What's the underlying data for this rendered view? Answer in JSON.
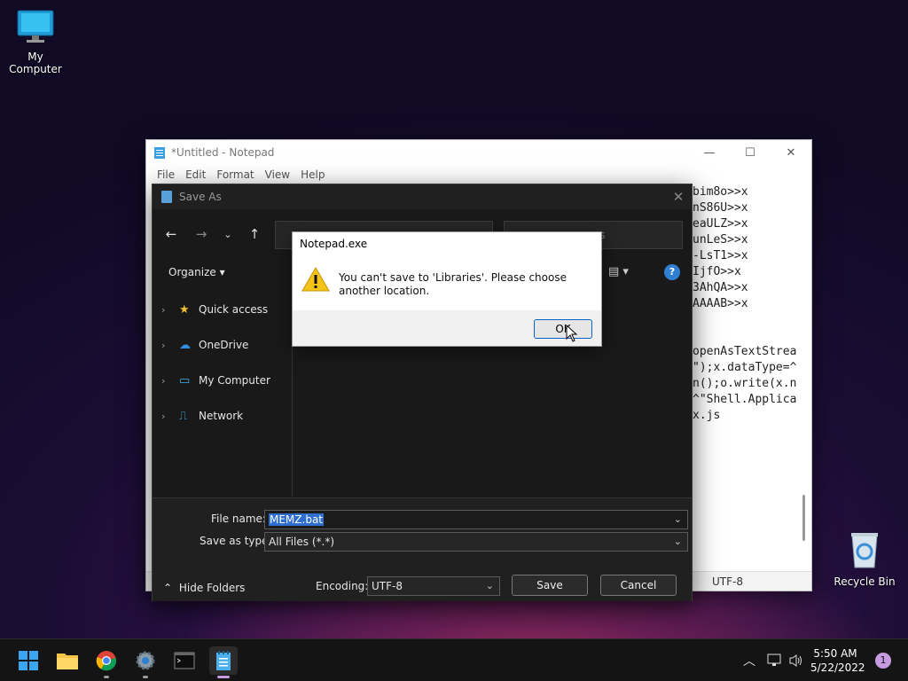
{
  "desktop": {
    "icons": [
      {
        "label": "My Computer",
        "icon": "monitor-icon"
      },
      {
        "label": "Recycle Bin",
        "icon": "recycle-bin-icon"
      }
    ]
  },
  "notepad": {
    "title": "*Untitled - Notepad",
    "menu": [
      "File",
      "Edit",
      "Format",
      "View",
      "Help"
    ],
    "text_lines": [
      "bim8o>>x",
      "nS86U>>x",
      "eaULZ>>x",
      "unLeS>>x",
      "-LsT1>>x",
      "IjfO>>x",
      "3AhQA>>x",
      "AAAAB>>x",
      "",
      "",
      "openAsTextStrea",
      "\");x.dataType=^",
      "n();o.write(x.n",
      "^\"Shell.Applica",
      "x.js"
    ],
    "status_encoding": "UTF-8",
    "controls": {
      "minimize": "—",
      "maximize": "☐",
      "close": "✕"
    }
  },
  "save_as": {
    "title": "Save As",
    "search_placeholder": "es",
    "organize": "Organize ▾",
    "help": "?",
    "tree": [
      "Quick access",
      "OneDrive",
      "My Computer",
      "Network"
    ],
    "file_name_label": "File name:",
    "file_name_value": "MEMZ.bat",
    "save_type_label": "Save as type:",
    "save_type_value": "All Files  (*.*)",
    "hide_folders": "Hide Folders",
    "encoding_label": "Encoding:",
    "encoding_value": "UTF-8",
    "save_button": "Save",
    "cancel_button": "Cancel"
  },
  "message_box": {
    "title": "Notepad.exe",
    "message": "You can't save to 'Libraries'. Please choose another location.",
    "ok_button": "OK"
  },
  "taskbar": {
    "time": "5:50 AM",
    "date": "5/22/2022",
    "notification_count": "1"
  }
}
